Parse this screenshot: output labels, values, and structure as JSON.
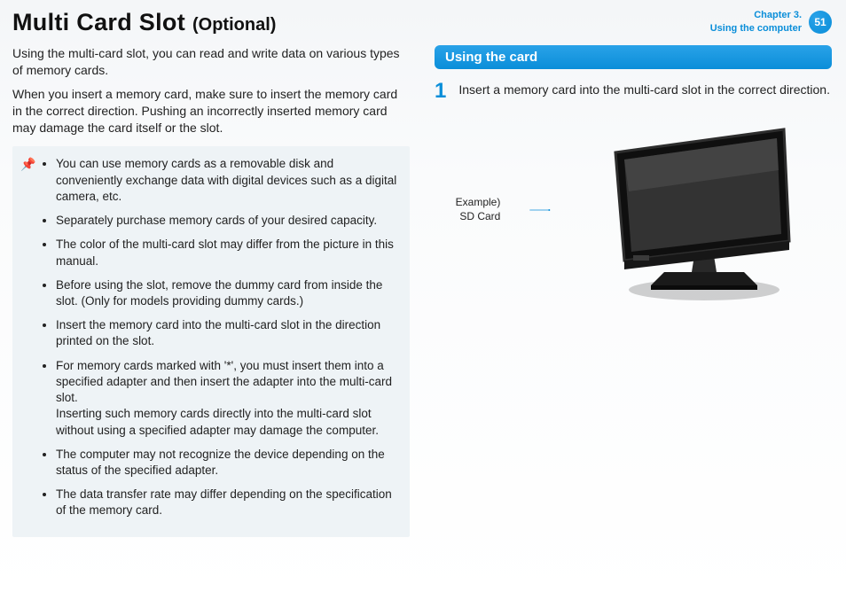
{
  "header": {
    "title": "Multi Card Slot",
    "subtitle": "(Optional)",
    "breadcrumb_line1": "Chapter 3.",
    "breadcrumb_line2": "Using the computer",
    "page_number": "51"
  },
  "intro": {
    "p1": "Using the multi-card slot, you can read and write data on various types of memory cards.",
    "p2": "When you insert a memory card, make sure to insert the memory card in the correct direction. Pushing an incorrectly inserted memory card may damage the card itself or the slot."
  },
  "notes": {
    "items": [
      "You can use memory cards as a removable disk and conveniently exchange data with digital devices such as a digital camera, etc.",
      "Separately purchase memory cards of your desired capacity.",
      "The color of the multi-card slot may differ from the picture in this manual.",
      "Before using the slot, remove the dummy card from inside the slot. (Only for models providing dummy cards.)",
      "Insert the memory card into the multi-card slot in the direction printed on the slot.",
      "For memory cards marked with '*', you must insert them into a specified adapter and then insert the adapter into the multi-card slot.\nInserting such memory cards directly into the multi-card slot without using a specified adapter may damage the computer.",
      "The computer may not recognize the device depending on the status of the specified adapter.",
      "The data transfer rate may differ depending on the specification of the memory card."
    ]
  },
  "right": {
    "section_title": "Using the card",
    "step1_num": "1",
    "step1_text": "Insert a memory card into the multi-card slot in the correct direction.",
    "example_line1": "Example)",
    "example_line2": "SD Card"
  }
}
